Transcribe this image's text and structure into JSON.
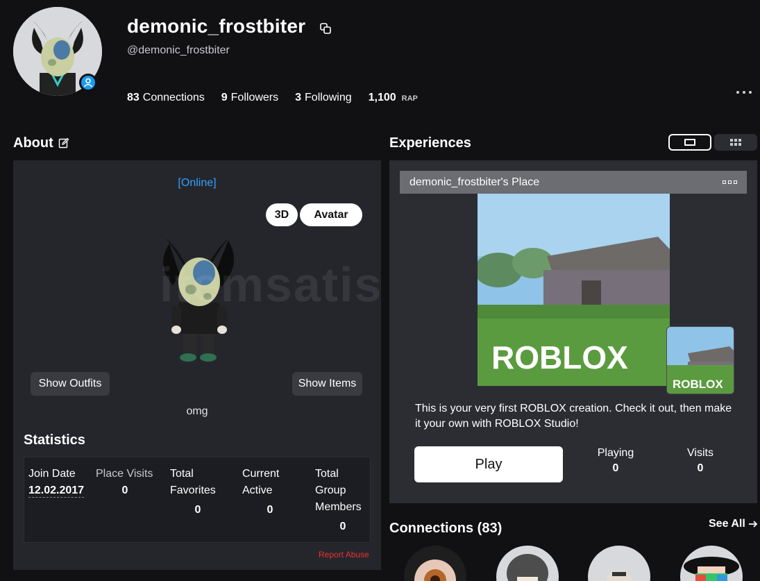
{
  "profile": {
    "display_name": "demonic_frostbiter",
    "username": "@demonic_frostbiter",
    "stats": [
      {
        "num": "83",
        "label": "Connections"
      },
      {
        "num": "9",
        "label": "Followers"
      },
      {
        "num": "3",
        "label": "Following"
      }
    ],
    "rap_value": "1,100",
    "rap_label": "RAP",
    "online_badge_color": "#1a9bf0"
  },
  "about": {
    "title": "About",
    "status": "[Online]",
    "btn_3d": "3D",
    "btn_avatar": "Avatar",
    "show_outfits": "Show Outfits",
    "show_items": "Show Items",
    "blurb": "omg"
  },
  "statistics": {
    "title": "Statistics",
    "join_date_label": "Join Date",
    "join_date_value": "12.02.2017",
    "place_visits_label": "Place Visits",
    "place_visits_value": "0",
    "total_favorites_label_1": "Total",
    "total_favorites_label_2": "Favorites",
    "total_favorites_value": "0",
    "current_active_label_1": "Current",
    "current_active_label_2": "Active",
    "current_active_value": "0",
    "group_members_label_1": "Total",
    "group_members_label_2": "Group",
    "group_members_label_3": "Members",
    "group_members_value": "0",
    "report": "Report Abuse"
  },
  "experiences": {
    "title": "Experiences",
    "place_name": "demonic_frostbiter's Place",
    "thumb_logo": "ROBLOX",
    "mini_logo": "ROBLOX",
    "description": "This is your very first ROBLOX creation. Check it out, then make it your own with ROBLOX Studio!",
    "play": "Play",
    "playing_label": "Playing",
    "playing_value": "0",
    "visits_label": "Visits",
    "visits_value": "0"
  },
  "connections": {
    "title": "Connections (83)",
    "see_all": "See All"
  },
  "watermark": "itemsatis",
  "colors": {
    "background": "#111114",
    "panel": "#24262c",
    "accent_online": "#33a2ff",
    "report": "#f0312f"
  }
}
